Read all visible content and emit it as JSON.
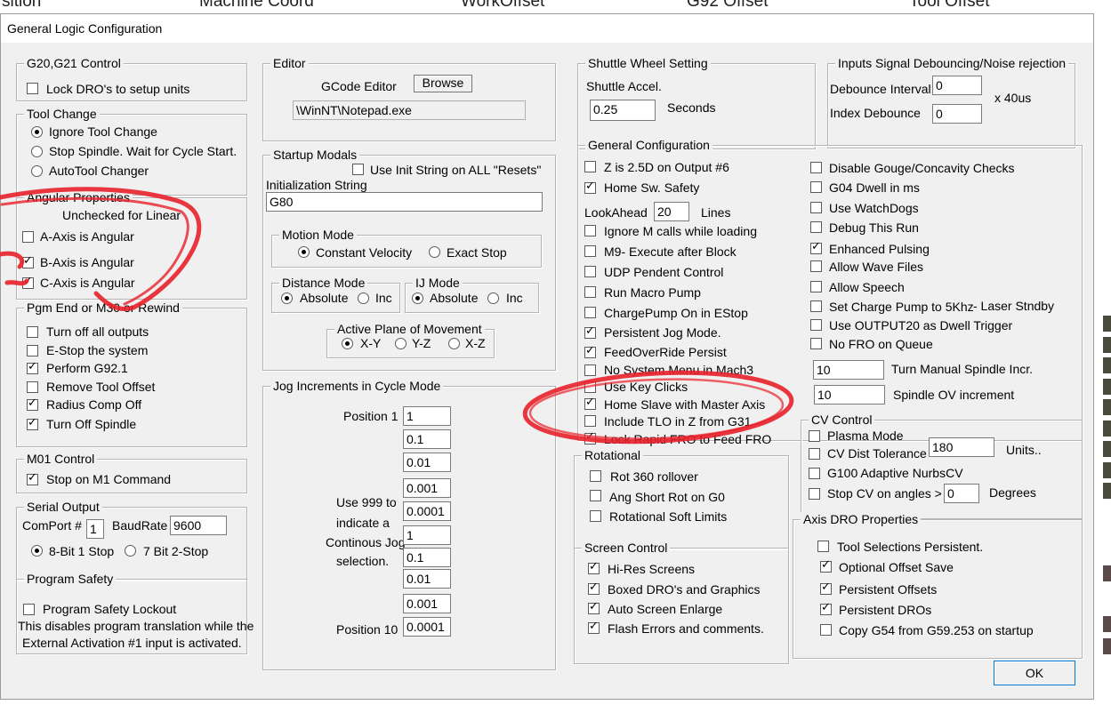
{
  "background_tabs": [
    "sition",
    "Machine Coord",
    "WorkOffset",
    "G92 Offset",
    "Tool Offset"
  ],
  "window_title": "General Logic Configuration",
  "g20g21": {
    "title": "G20,G21 Control",
    "lock_dro": "Lock DRO's to setup units"
  },
  "tool_change": {
    "title": "Tool Change",
    "options": [
      "Ignore Tool Change",
      "Stop Spindle. Wait for Cycle Start.",
      "AutoTool Changer"
    ]
  },
  "angular": {
    "title": "Angular Properties",
    "subtitle": "Unchecked for Linear",
    "a": "A-Axis is Angular",
    "b": "B-Axis is Angular",
    "c": "C-Axis is Angular"
  },
  "pgm_end": {
    "title": "Pgm End or M30 or Rewind",
    "items": [
      "Turn off all outputs",
      "E-Stop the system",
      "Perform G92.1",
      "Remove Tool Offset",
      "Radius Comp Off",
      "Turn Off Spindle"
    ]
  },
  "m01": {
    "title": "M01 Control",
    "stop": "Stop on M1 Command"
  },
  "serial": {
    "title": "Serial Output",
    "comport_label": "ComPort #",
    "comport": "1",
    "baud_label": "BaudRate",
    "baud": "9600",
    "opt1": "8-Bit 1 Stop",
    "opt2": "7 Bit 2-Stop"
  },
  "safety": {
    "title": "Program Safety",
    "lockout": "Program Safety Lockout",
    "desc1": "This disables program translation while the",
    "desc2": "External Activation #1 input is activated."
  },
  "editor": {
    "title": "Editor",
    "label": "GCode Editor",
    "browse": "Browse",
    "path": "\\WinNT\\Notepad.exe"
  },
  "startup": {
    "title": "Startup Modals",
    "use_init": "Use Init String on ALL  \"Resets\"",
    "init_label": "Initialization String",
    "init_value": "G80"
  },
  "motion": {
    "title": "Motion Mode",
    "cv": "Constant Velocity",
    "es": "Exact Stop"
  },
  "distance": {
    "title": "Distance Mode",
    "abs": "Absolute",
    "inc": "Inc"
  },
  "ij": {
    "title": "IJ Mode",
    "abs": "Absolute",
    "inc": "Inc"
  },
  "plane": {
    "title": "Active Plane of Movement",
    "xy": "X-Y",
    "yz": "Y-Z",
    "xz": "X-Z"
  },
  "jog": {
    "title": "Jog Increments in Cycle Mode",
    "pos1": "Position 1",
    "pos10": "Position 10",
    "note": [
      "Use 999 to",
      "indicate a",
      "Continous Jog",
      "selection."
    ],
    "values": [
      "1",
      "0.1",
      "0.01",
      "0.001",
      "0.0001",
      "1",
      "0.1",
      "0.01",
      "0.001",
      "0.0001"
    ]
  },
  "shuttle": {
    "title": "Shuttle Wheel Setting",
    "accel_label": "Shuttle Accel.",
    "accel": "0.25",
    "unit": "Seconds"
  },
  "debounce": {
    "title": "Inputs Signal Debouncing/Noise rejection",
    "interval_label": "Debounce Interval:",
    "interval": "0",
    "index_label": "Index Debounce",
    "index": "0",
    "unit": "x 40us"
  },
  "general": {
    "title": "General Configuration",
    "z25d": "Z is 2.5D on Output #6",
    "home_safety": "Home Sw. Safety",
    "lookahead_label": "LookAhead",
    "lookahead": "20",
    "lines": "Lines",
    "ignore_m": "Ignore M calls while loading",
    "m9": "M9- Execute after Block",
    "udp": "UDP Pendent Control",
    "macro": "Run Macro Pump",
    "chargepump": "ChargePump On in EStop",
    "persist_jog": "Persistent Jog Mode.",
    "feed_persist": "FeedOverRide Persist",
    "no_sys_menu": "No System Menu in Mach3",
    "key_clicks": "Use Key Clicks",
    "home_slave": "Home Slave with Master Axis",
    "include_tlo": "Include TLO in Z from G31",
    "lock_rapid": "Lock Rapid FRO to Feed FRO",
    "gouge": "Disable Gouge/Concavity Checks",
    "g04": "G04 Dwell in ms",
    "watchdogs": "Use WatchDogs",
    "debug": "Debug This Run",
    "enhanced": "Enhanced Pulsing",
    "wave": "Allow Wave Files",
    "speech": "Allow Speech",
    "charge5k": "Set Charge Pump to 5Khz",
    "laser": "- Laser Stndby",
    "output20": "Use OUTPUT20 as Dwell Trigger",
    "no_fro": "No FRO on Queue",
    "turn_manual": "10",
    "turn_manual_label": "Turn Manual Spindle Incr.",
    "spindle_ov": "10",
    "spindle_ov_label": "Spindle OV increment"
  },
  "cv": {
    "title": "CV Control",
    "plasma": "Plasma Mode",
    "dist_label": "CV Dist Tolerance",
    "dist": "180",
    "units": "Units..",
    "g100": "G100 Adaptive NurbsCV",
    "stop_label": "Stop CV on angles >",
    "stop": "0",
    "degrees": "Degrees"
  },
  "rotational": {
    "title": "Rotational",
    "rot360": "Rot 360 rollover",
    "angshort": "Ang Short Rot on G0",
    "softlimits": "Rotational Soft Limits"
  },
  "screen": {
    "title": "Screen Control",
    "hires": "Hi-Res Screens",
    "boxed": "Boxed DRO's and Graphics",
    "auto": "Auto Screen Enlarge",
    "flash": "Flash Errors and comments."
  },
  "axis_dro": {
    "title": "Axis DRO Properties",
    "tool_sel": "Tool Selections Persistent.",
    "opt_offset": "Optional Offset Save",
    "pers_offsets": "Persistent Offsets",
    "pers_dros": "Persistent DROs",
    "copy_g54": "Copy G54 from G59.253 on startup"
  },
  "ok_label": "OK",
  "colors": {
    "annotation": "#e8202a",
    "dialog_bg": "#f0f0f0"
  }
}
